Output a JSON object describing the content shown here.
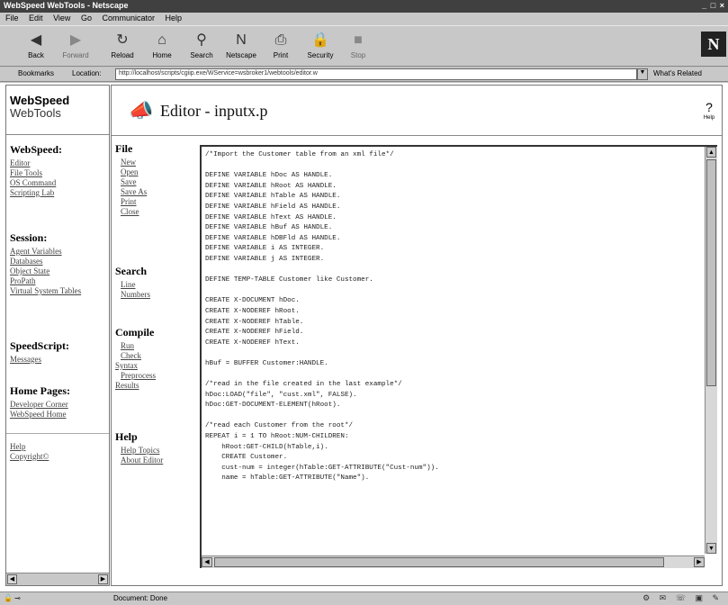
{
  "window": {
    "title": "WebSpeed WebTools - Netscape",
    "controls": "_ □ ×"
  },
  "menu": [
    "File",
    "Edit",
    "View",
    "Go",
    "Communicator",
    "Help"
  ],
  "toolbar": [
    {
      "label": "Back",
      "icon": "◀"
    },
    {
      "label": "Forward",
      "icon": "▶"
    },
    {
      "label": "Reload",
      "icon": "↻"
    },
    {
      "label": "Home",
      "icon": "⌂"
    },
    {
      "label": "Search",
      "icon": "⚲"
    },
    {
      "label": "Netscape",
      "icon": "N"
    },
    {
      "label": "Print",
      "icon": "⎙"
    },
    {
      "label": "Security",
      "icon": "🔒"
    },
    {
      "label": "Stop",
      "icon": "■"
    }
  ],
  "throbber": "N",
  "location": {
    "bookmarks_label": "Bookmarks",
    "location_label": "Location:",
    "url": "http://localhost/scripts/cgiip.exe/WService=wsbroker1/webtools/editor.w",
    "related_label": "What's Related"
  },
  "logo": {
    "line1": "WebSpeed",
    "line2": "WebTools"
  },
  "sidebar": {
    "sections": [
      {
        "title": "WebSpeed:",
        "items": [
          "Editor",
          "File Tools",
          "OS Command",
          "Scripting Lab"
        ]
      },
      {
        "title": "Session:",
        "items": [
          "Agent Variables",
          "Databases",
          "Object State",
          "ProPath",
          "Virtual System Tables"
        ]
      },
      {
        "title": "SpeedScript:",
        "items": [
          "Messages"
        ]
      },
      {
        "title": "Home Pages:",
        "items": [
          "Developer Corner",
          "WebSpeed Home"
        ]
      },
      {
        "title": "",
        "items": [
          "Help",
          "Copyright©"
        ]
      }
    ]
  },
  "header": {
    "title": "Editor - inputx.p",
    "help_label": "Help"
  },
  "tools": {
    "file": {
      "title": "File",
      "items": [
        "New",
        "Open",
        "Save",
        "Save As",
        "Print",
        "Close"
      ]
    },
    "search": {
      "title": "Search",
      "items": [
        "Line",
        "Numbers"
      ]
    },
    "compile": {
      "title": "Compile",
      "items": [
        "Run",
        "Check",
        "Syntax",
        "Preprocess",
        "Results"
      ]
    },
    "help": {
      "title": "Help",
      "items": [
        "Help Topics",
        "About Editor"
      ]
    }
  },
  "code_lines": [
    "/*Import the Customer table from an xml file*/",
    "",
    "DEFINE VARIABLE hDoc AS HANDLE.",
    "DEFINE VARIABLE hRoot AS HANDLE.",
    "DEFINE VARIABLE hTable AS HANDLE.",
    "DEFINE VARIABLE hField AS HANDLE.",
    "DEFINE VARIABLE hText AS HANDLE.",
    "DEFINE VARIABLE hBuf AS HANDLE.",
    "DEFINE VARIABLE hDBFld AS HANDLE.",
    "DEFINE VARIABLE i AS INTEGER.",
    "DEFINE VARIABLE j AS INTEGER.",
    "",
    "DEFINE TEMP-TABLE Customer like Customer.",
    "",
    "CREATE X-DOCUMENT hDoc.",
    "CREATE X-NODEREF hRoot.",
    "CREATE X-NODEREF hTable.",
    "CREATE X-NODEREF hField.",
    "CREATE X-NODEREF hText.",
    "",
    "hBuf = BUFFER Customer:HANDLE.",
    "",
    "/*read in the file created in the last example*/",
    "hDoc:LOAD(\"file\", \"cust.xml\", FALSE).",
    "hDoc:GET-DOCUMENT-ELEMENT(hRoot).",
    "",
    "/*read each Customer from the root*/",
    "REPEAT i = 1 TO hRoot:NUM-CHILDREN:",
    "    hRoot:GET-CHILD(hTable,i).",
    "    CREATE Customer.",
    "    cust-num = integer(hTable:GET-ATTRIBUTE(\"Cust-num\")).",
    "    name = hTable:GET-ATTRIBUTE(\"Name\")."
  ],
  "status": {
    "text": "Document: Done",
    "tray": "⚙ ✉ ☏ ▣ ✎"
  }
}
